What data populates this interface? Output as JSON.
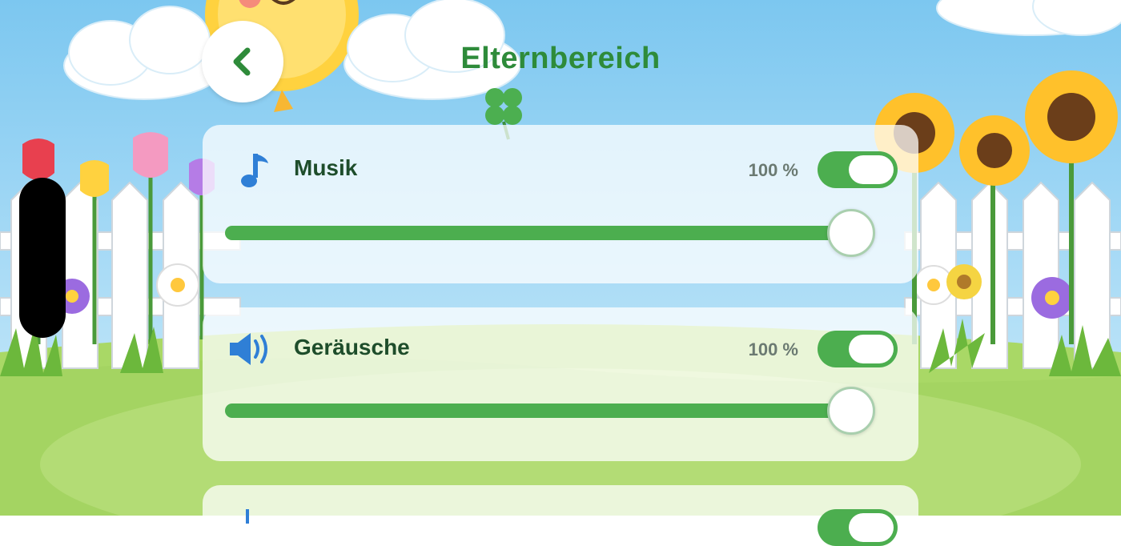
{
  "header": {
    "title": "Elternbereich",
    "back_icon": "chevron-left-icon"
  },
  "settings": [
    {
      "label": "Musik",
      "icon": "music-note-icon",
      "percent_text": "100 %",
      "enabled": true,
      "volume": 1.0
    },
    {
      "label": "Geräusche",
      "icon": "speaker-icon",
      "percent_text": "100 %",
      "enabled": true,
      "volume": 1.0
    },
    {
      "icon": "partial-icon",
      "enabled": true
    }
  ],
  "colors": {
    "accent_green": "#4cae4f",
    "title_green": "#2e8b3a",
    "label_dark_green": "#1e4d2b",
    "icon_blue": "#2f7fd6",
    "sky_top": "#7cc7f0",
    "grass": "#8cc850"
  }
}
